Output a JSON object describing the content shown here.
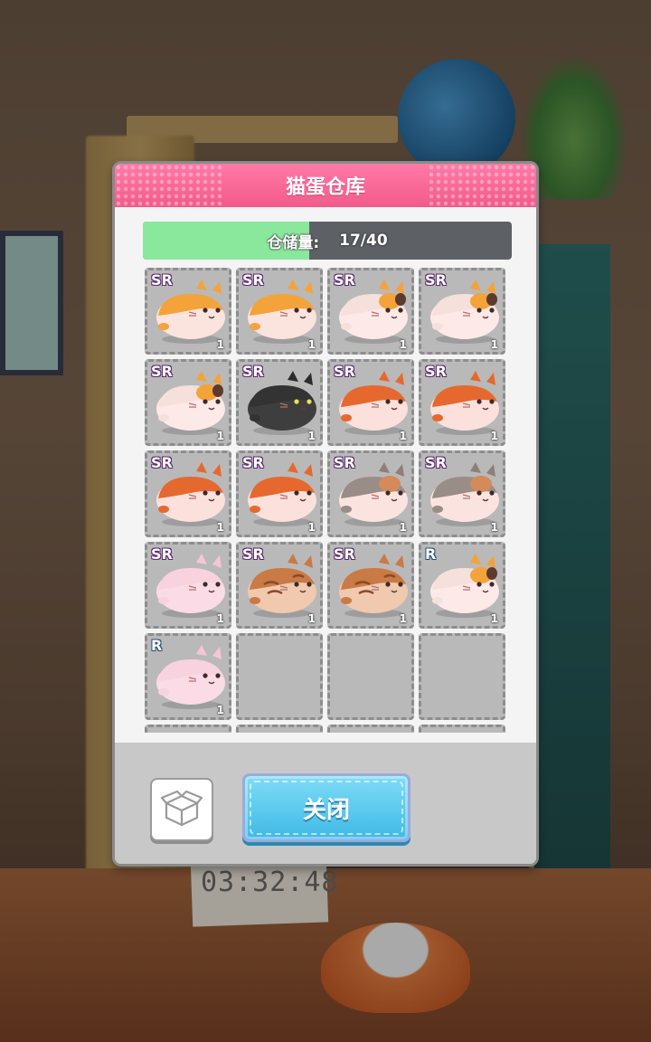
{
  "background": {
    "timer": "03:32:48"
  },
  "dialog": {
    "title": "猫蛋仓库",
    "storage": {
      "label": "仓储量:",
      "value": "17/40",
      "used": 17,
      "capacity": 40
    },
    "cells": [
      {
        "rarity": "SR",
        "count": "1",
        "cat": "orange"
      },
      {
        "rarity": "SR",
        "count": "1",
        "cat": "orange"
      },
      {
        "rarity": "SR",
        "count": "1",
        "cat": "calico"
      },
      {
        "rarity": "SR",
        "count": "1",
        "cat": "calico"
      },
      {
        "rarity": "SR",
        "count": "1",
        "cat": "calico"
      },
      {
        "rarity": "SR",
        "count": "1",
        "cat": "black"
      },
      {
        "rarity": "SR",
        "count": "1",
        "cat": "ginger"
      },
      {
        "rarity": "SR",
        "count": "1",
        "cat": "ginger"
      },
      {
        "rarity": "SR",
        "count": "1",
        "cat": "ginger"
      },
      {
        "rarity": "SR",
        "count": "1",
        "cat": "ginger"
      },
      {
        "rarity": "SR",
        "count": "1",
        "cat": "grey-calico"
      },
      {
        "rarity": "SR",
        "count": "1",
        "cat": "grey-calico"
      },
      {
        "rarity": "SR",
        "count": "1",
        "cat": "pink"
      },
      {
        "rarity": "SR",
        "count": "1",
        "cat": "tabby"
      },
      {
        "rarity": "SR",
        "count": "1",
        "cat": "tabby"
      },
      {
        "rarity": "R",
        "count": "1",
        "cat": "calico"
      },
      {
        "rarity": "R",
        "count": "1",
        "cat": "pink"
      },
      {
        "rarity": "",
        "count": "",
        "cat": ""
      },
      {
        "rarity": "",
        "count": "",
        "cat": ""
      },
      {
        "rarity": "",
        "count": "",
        "cat": ""
      },
      {
        "rarity": "",
        "count": "",
        "cat": ""
      },
      {
        "rarity": "",
        "count": "",
        "cat": ""
      },
      {
        "rarity": "",
        "count": "",
        "cat": ""
      },
      {
        "rarity": "",
        "count": "",
        "cat": ""
      }
    ],
    "footer": {
      "box_icon": "box-icon",
      "close_label": "关闭"
    }
  },
  "colors": {
    "header": "#f25a8c",
    "progress_fill": "#8ae89d",
    "close_button": "#3fb9e6"
  }
}
